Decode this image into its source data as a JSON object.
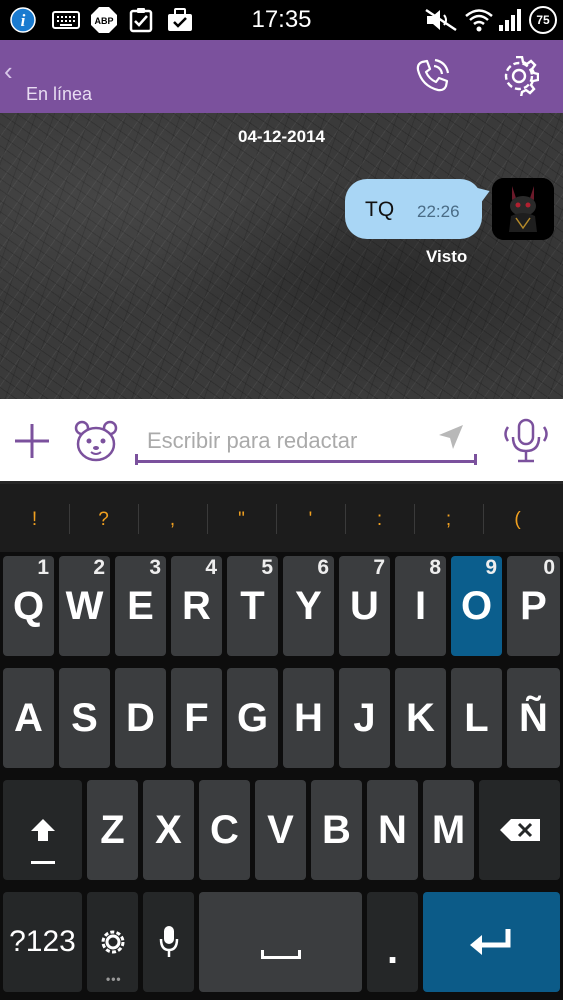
{
  "status_bar": {
    "time": "17:35",
    "battery": "75",
    "left_icons": [
      "info-icon",
      "keyboard-icon",
      "adblock-icon",
      "clipboard-check-icon",
      "briefcase-check-icon"
    ],
    "adblock_label": "ABP",
    "right_icons": [
      "mute-icon",
      "wifi-icon",
      "signal-icon",
      "battery-icon"
    ]
  },
  "header": {
    "status": "En línea",
    "call_icon": "phone-call-icon",
    "settings_icon": "gear-icon",
    "color": "#7b519d"
  },
  "chat": {
    "date": "04-12-2014",
    "messages": [
      {
        "text": "TQ",
        "time": "22:26",
        "direction": "outgoing",
        "bubble_color": "#a9d6f5"
      }
    ],
    "seen_label": "Visto"
  },
  "input_bar": {
    "placeholder": "Escribir para redactar",
    "add_icon": "plus-icon",
    "sticker_icon": "bear-face-icon",
    "send_icon": "send-arrow-icon",
    "mic_icon": "microphone-icon",
    "accent": "#7b519d"
  },
  "keyboard": {
    "suggestions": [
      "!",
      "?",
      ",",
      "\"",
      "'",
      ":",
      ";",
      "("
    ],
    "row1": [
      {
        "key": "Q",
        "num": "1"
      },
      {
        "key": "W",
        "num": "2"
      },
      {
        "key": "E",
        "num": "3"
      },
      {
        "key": "R",
        "num": "4"
      },
      {
        "key": "T",
        "num": "5"
      },
      {
        "key": "Y",
        "num": "6"
      },
      {
        "key": "U",
        "num": "7"
      },
      {
        "key": "I",
        "num": "8"
      },
      {
        "key": "O",
        "num": "9"
      },
      {
        "key": "P",
        "num": "0"
      }
    ],
    "row2": [
      "A",
      "S",
      "D",
      "F",
      "G",
      "H",
      "J",
      "K",
      "L",
      "Ñ"
    ],
    "row3": [
      "Z",
      "X",
      "C",
      "V",
      "B",
      "N",
      "M"
    ],
    "symbols_label": "?123",
    "period_label": ".",
    "space_label": "___",
    "highlighted_key": "O",
    "accent": "#0b5e8d"
  }
}
